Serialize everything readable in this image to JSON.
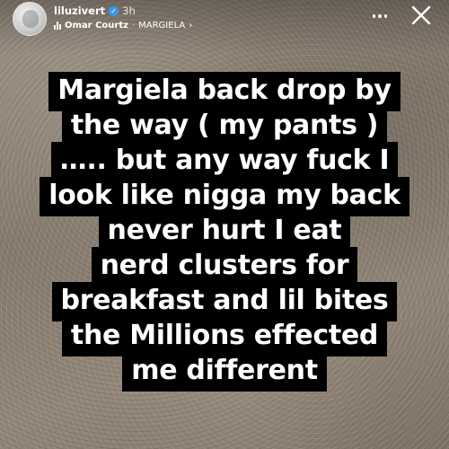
{
  "header": {
    "username": "liluzivert",
    "verified_badge": "✓",
    "timestamp": "3h",
    "music": {
      "icon": "music-bars-icon",
      "artist": "Omar Courtz",
      "separator": "·",
      "track": "MARGIELA",
      "chevron": "›"
    },
    "more_icon": "more-horizontal-icon",
    "close_icon": "close-icon"
  },
  "caption": {
    "lines": [
      "Margiela back drop by",
      "the way ( my pants )",
      "….. but any way fuck I",
      "look like nigga my back",
      "never hurt I eat",
      "nerd clusters for",
      "breakfast and lil bites",
      "the Millions effected",
      "me different"
    ],
    "text_color": "#ffffff",
    "background_color": "#000000"
  },
  "colors": {
    "verified": "#3897f0",
    "background_texture": "#8a7d70"
  }
}
